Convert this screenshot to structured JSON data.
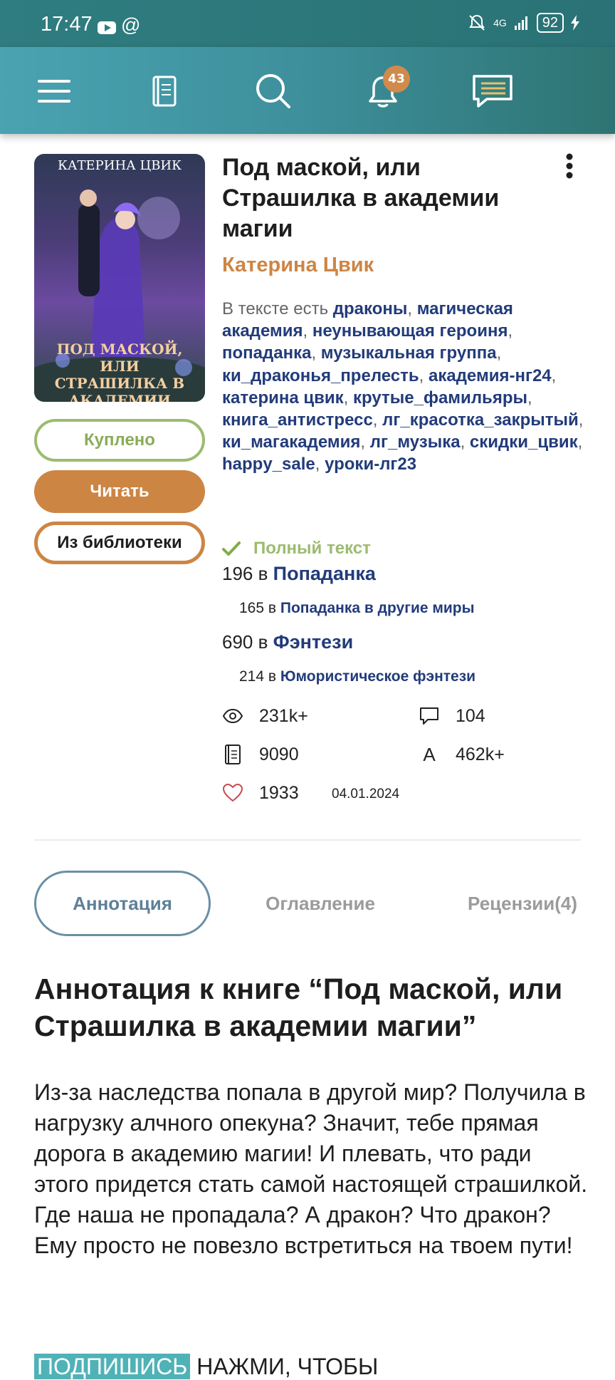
{
  "status": {
    "time": "17:47",
    "network": "4G",
    "battery": "92"
  },
  "app_bar": {
    "notifications_count": "43"
  },
  "book": {
    "title": "Под маской, или Страшилка в академии магии",
    "author": "Катерина Цвик",
    "cover": {
      "author_text": "Катерина Цвик",
      "title_text": "Под маской, или Страшилка в академии"
    },
    "tags_prefix": "В тексте есть",
    "tags": [
      "драконы",
      "магическая академия",
      "неунывающая героиня",
      "попаданка",
      "музыкальная группа",
      "ки_драконья_прелесть",
      "академия-нг24",
      "катерина цвик",
      "крутые_фамильяры",
      "книга_антистресс",
      "лг_красотка_закрытый",
      "ки_магакадемия",
      "лг_музыка",
      "скидки_цвик",
      "happy_sale",
      "уроки-лг23"
    ],
    "status": "Полный текст",
    "rankings": [
      {
        "pos": "196",
        "in": "в",
        "genre": "Попаданка"
      },
      {
        "pos": "165",
        "in": "в",
        "genre": "Попаданка в другие миры"
      },
      {
        "pos": "690",
        "in": "в",
        "genre": "Фэнтези"
      },
      {
        "pos": "214",
        "in": "в",
        "genre": "Юмористическое фэнтези"
      }
    ],
    "stats": {
      "views": "231k+",
      "comments": "104",
      "pages": "9090",
      "chars": "462k+",
      "likes": "1933",
      "date": "04.01.2024"
    }
  },
  "buttons": {
    "bought": "Куплено",
    "read": "Читать",
    "library": "Из библиотеки"
  },
  "tabs": [
    {
      "label": "Аннотация"
    },
    {
      "label": "Оглавление"
    },
    {
      "label": "Рецензии(4)"
    }
  ],
  "annotation": {
    "heading": "Аннотация к книге “Под маской, или Страшилка в академии магии”",
    "text": "Из-за наследства попала в другой мир? Получила в нагрузку алчного опекуна? Значит, тебе прямая дорога в академию магии! И плевать, что ради этого придется стать самой настоящей страшилкой. Где наша не пропадала? А дракон? Что дракон? Ему просто не повезло встретиться на твоем пути!",
    "cta_highlight": "ПОДПИШИСЬ",
    "cta_text": "НАЖМИ, ЧТОБЫ"
  },
  "colors": {
    "accent": "#cd8544",
    "link": "#223b7a",
    "success": "#9dbb70",
    "appbar": "#3d8f9b"
  }
}
